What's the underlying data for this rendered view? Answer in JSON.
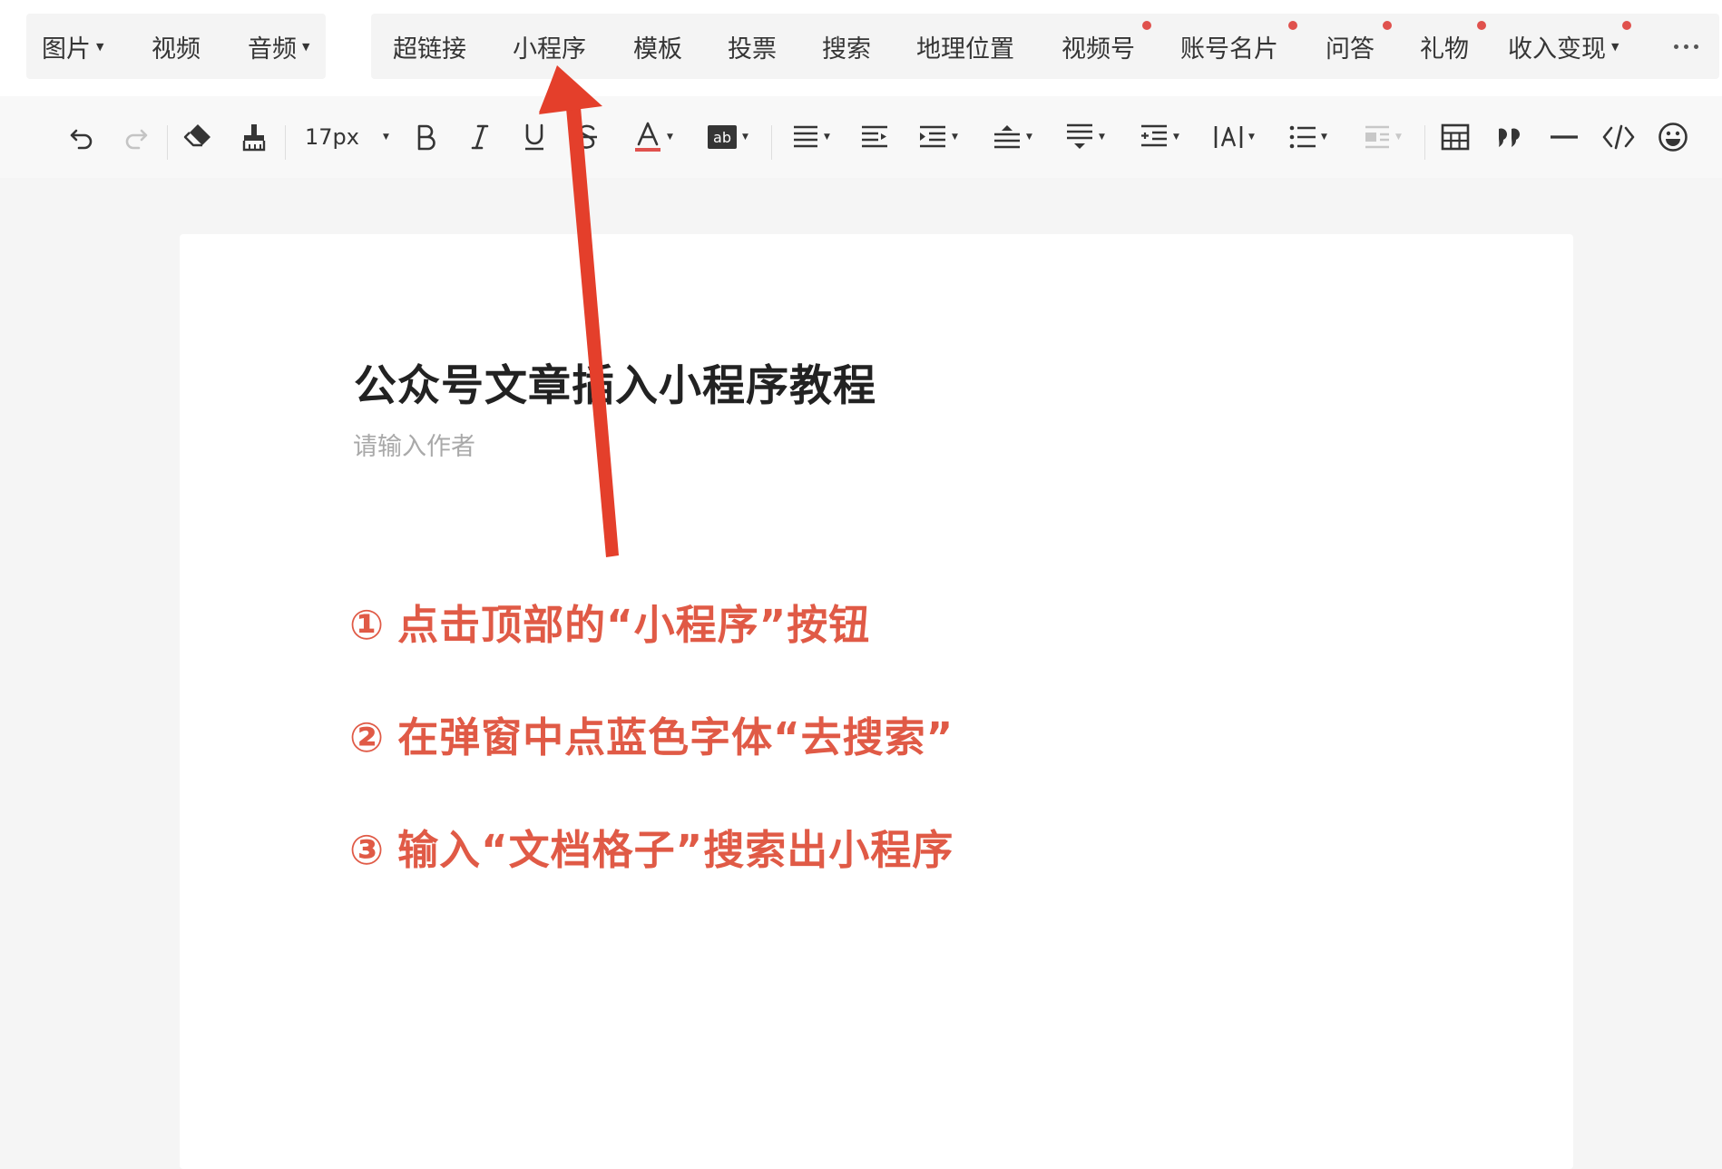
{
  "insert_menu": {
    "group1": [
      {
        "label": "图片",
        "caret": true
      },
      {
        "label": "视频",
        "caret": false
      },
      {
        "label": "音频",
        "caret": true
      }
    ],
    "group2": [
      {
        "label": "超链接",
        "dot": false,
        "caret": false
      },
      {
        "label": "小程序",
        "dot": false,
        "caret": false
      },
      {
        "label": "模板",
        "dot": false,
        "caret": false
      },
      {
        "label": "投票",
        "dot": false,
        "caret": false
      },
      {
        "label": "搜索",
        "dot": false,
        "caret": false
      },
      {
        "label": "地理位置",
        "dot": false,
        "caret": false
      },
      {
        "label": "视频号",
        "dot": true,
        "caret": false
      },
      {
        "label": "账号名片",
        "dot": true,
        "caret": false
      },
      {
        "label": "问答",
        "dot": true,
        "caret": false
      },
      {
        "label": "礼物",
        "dot": true,
        "caret": false
      },
      {
        "label": "收入变现",
        "dot": true,
        "caret": true
      }
    ],
    "more_icon": "more-horizontal-icon",
    "dot_color": "#e0514d"
  },
  "toolbar": {
    "font_size": "17px",
    "font_color_underline": "#e0514d",
    "icons": [
      "undo-icon",
      "redo-icon",
      "eraser-icon",
      "format-brush-icon",
      "font-size-select",
      "bold-icon",
      "italic-icon",
      "underline-icon",
      "strikethrough-icon",
      "font-color-icon",
      "background-color-icon",
      "align-icon",
      "indent-icon",
      "first-line-indent-icon",
      "paragraph-spacing-before-icon",
      "paragraph-spacing-after-icon",
      "line-height-icon",
      "letter-spacing-icon",
      "list-icon",
      "float-icon",
      "table-icon",
      "quote-icon",
      "divider-icon",
      "code-icon",
      "emoji-icon"
    ]
  },
  "document": {
    "title": "公众号文章插入小程序教程",
    "author_placeholder": "请输入作者",
    "steps": [
      {
        "num": "①",
        "text": "点击顶部的“小程序”按钮"
      },
      {
        "num": "②",
        "text": "在弹窗中点蓝色字体“去搜索”"
      },
      {
        "num": "③",
        "text": "输入“文档格子”搜索出小程序"
      }
    ],
    "step_color": "#e05a46"
  },
  "annotation": {
    "arrow_color": "#e43f2b"
  }
}
